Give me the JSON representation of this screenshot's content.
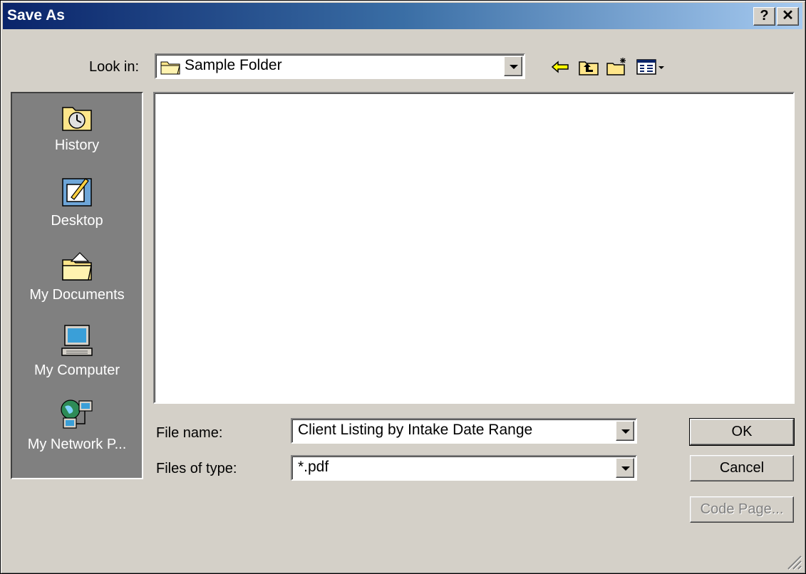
{
  "window": {
    "title": "Save As"
  },
  "titlebar": {
    "help_label": "?",
    "close_label": "✕"
  },
  "look_in": {
    "label": "Look in:",
    "value": "Sample Folder"
  },
  "places": [
    {
      "label": "History",
      "icon": "history-icon"
    },
    {
      "label": "Desktop",
      "icon": "desktop-icon"
    },
    {
      "label": "My Documents",
      "icon": "my-documents-icon"
    },
    {
      "label": "My Computer",
      "icon": "my-computer-icon"
    },
    {
      "label": "My Network P...",
      "icon": "network-places-icon"
    }
  ],
  "file_name": {
    "label": "File name:",
    "value": "Client Listing by Intake Date Range"
  },
  "file_type": {
    "label": "Files of type:",
    "value": "*.pdf"
  },
  "buttons": {
    "ok": "OK",
    "cancel": "Cancel",
    "code_page": "Code Page..."
  },
  "colors": {
    "titlebar_start": "#0a246a",
    "titlebar_end": "#a6caf0",
    "face": "#d4d0c8",
    "places_bg": "#808080"
  }
}
